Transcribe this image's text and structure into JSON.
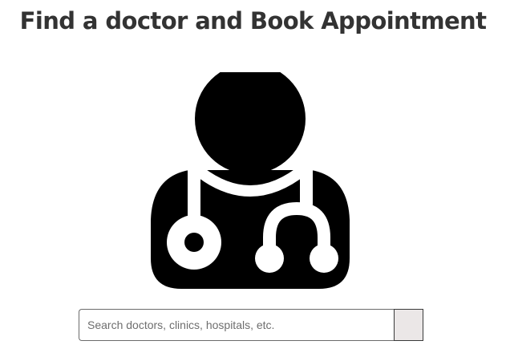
{
  "page": {
    "title": "Find a doctor and Book Appointment"
  },
  "illustration": {
    "icon": "doctor-with-stethoscope-icon",
    "color": "#000000"
  },
  "search": {
    "value": "",
    "placeholder": "Search doctors, clinics, hospitals, etc.",
    "button_color": "#ebe7e7"
  }
}
